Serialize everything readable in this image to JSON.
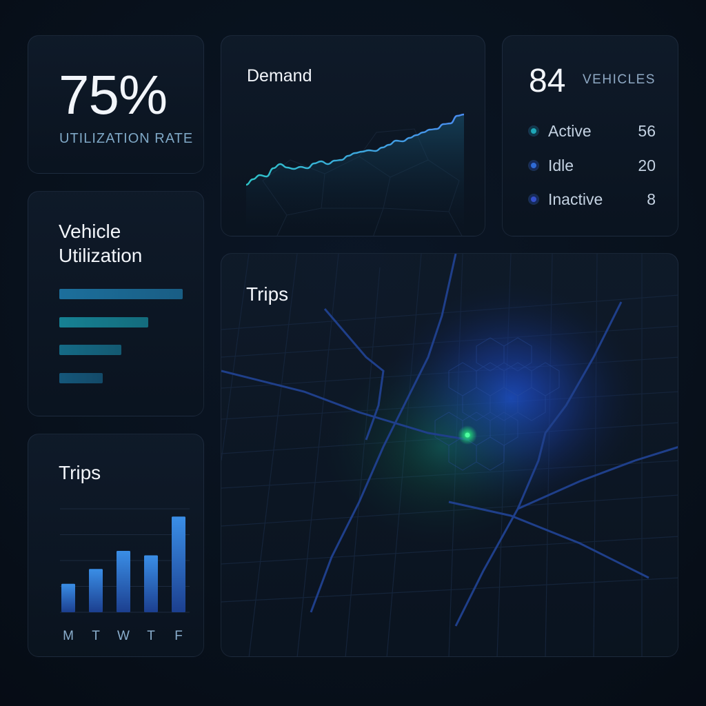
{
  "utilization": {
    "value": "75%",
    "label": "UTILIZATION RATE"
  },
  "demand": {
    "title": "Demand"
  },
  "vehicles": {
    "count": "84",
    "unit": "VEHICLES",
    "rows": [
      {
        "label": "Active",
        "value": "56",
        "color": "#1fa7b8"
      },
      {
        "label": "Idle",
        "value": "20",
        "color": "#2f6bd6"
      },
      {
        "label": "Inactive",
        "value": "8",
        "color": "#3550c9"
      }
    ]
  },
  "vehicle_utilization": {
    "title": "Vehicle Utilization",
    "bars": [
      {
        "fraction": 1.0,
        "color": "#1c6f9c"
      },
      {
        "fraction": 0.72,
        "color": "#168193"
      },
      {
        "fraction": 0.5,
        "color": "#156a85"
      },
      {
        "fraction": 0.35,
        "color": "#15577a"
      }
    ]
  },
  "trips_chart": {
    "title": "Trips"
  },
  "chart_data": [
    {
      "type": "line",
      "title": "Demand",
      "x": [
        0,
        1,
        2,
        3,
        4,
        5,
        6,
        7,
        8,
        9,
        10,
        11,
        12,
        13,
        14,
        15,
        16,
        17,
        18,
        19,
        20,
        21,
        22,
        23,
        24,
        25,
        26,
        27,
        28,
        29,
        30,
        31,
        32
      ],
      "y": [
        10,
        18,
        24,
        22,
        34,
        40,
        35,
        33,
        36,
        34,
        41,
        44,
        40,
        45,
        46,
        52,
        56,
        58,
        60,
        59,
        64,
        68,
        74,
        73,
        78,
        82,
        86,
        90,
        91,
        98,
        99,
        110,
        112
      ],
      "ylim": [
        0,
        130
      ]
    },
    {
      "type": "bar",
      "title": "Trips",
      "categories": [
        "M",
        "T",
        "W",
        "T",
        "F"
      ],
      "values": [
        44,
        67,
        95,
        88,
        148
      ],
      "ylim": [
        0,
        160
      ]
    }
  ],
  "map": {
    "title": "Trips",
    "accent_hot": "#1e4fd1",
    "accent_point": "#22d37a"
  }
}
